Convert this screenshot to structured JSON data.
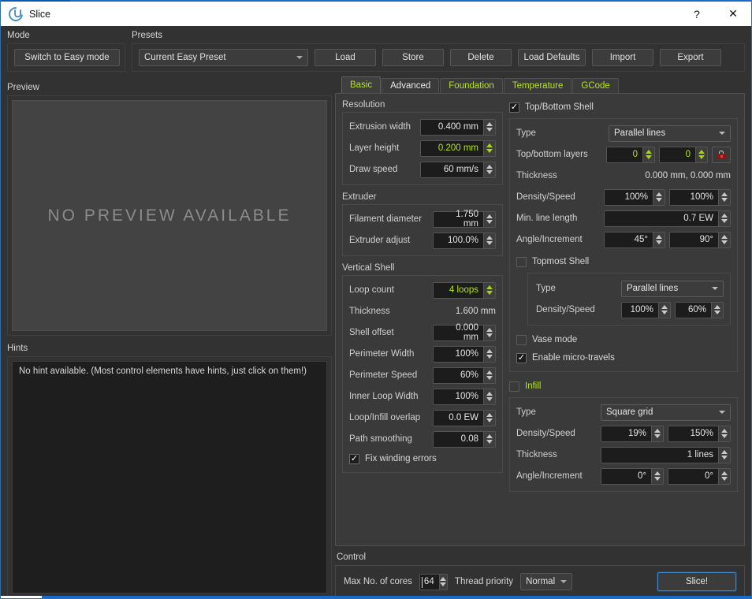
{
  "window": {
    "title": "Slice",
    "app_icon": "slice-logo-icon",
    "help_label": "?",
    "close_label": "✕"
  },
  "mode": {
    "group_label": "Mode",
    "switch_button": "Switch to Easy mode"
  },
  "presets": {
    "group_label": "Presets",
    "selected": "Current Easy Preset",
    "buttons": [
      "Load",
      "Store",
      "Delete",
      "Load Defaults",
      "Import",
      "Export"
    ]
  },
  "preview": {
    "group_label": "Preview",
    "placeholder": "NO  PREVIEW  AVAILABLE"
  },
  "hints": {
    "group_label": "Hints",
    "text": "No hint available. (Most control elements have hints, just click on them!)"
  },
  "tabs": [
    {
      "label": "Basic",
      "active": true,
      "color": "green"
    },
    {
      "label": "Advanced",
      "active": false,
      "color": "white"
    },
    {
      "label": "Foundation",
      "active": false,
      "color": "green"
    },
    {
      "label": "Temperature",
      "active": false,
      "color": "green"
    },
    {
      "label": "GCode",
      "active": false,
      "color": "green"
    }
  ],
  "basic": {
    "resolution": {
      "title": "Resolution",
      "rows": [
        {
          "label": "Extrusion width",
          "value": "0.400 mm",
          "modified": false
        },
        {
          "label": "Layer height",
          "value": "0.200 mm",
          "modified": true
        },
        {
          "label": "Draw speed",
          "value": "60 mm/s",
          "modified": false
        }
      ]
    },
    "extruder": {
      "title": "Extruder",
      "rows": [
        {
          "label": "Filament diameter",
          "value": "1.750 mm",
          "modified": false
        },
        {
          "label": "Extruder adjust",
          "value": "100.0%",
          "modified": false
        }
      ]
    },
    "vertical_shell": {
      "title": "Vertical Shell",
      "loop_count": {
        "label": "Loop count",
        "value": "4 loops",
        "modified": true
      },
      "thickness": {
        "label": "Thickness",
        "value": "1.600 mm"
      },
      "rows": [
        {
          "label": "Shell offset",
          "value": "0.000 mm",
          "modified": false
        },
        {
          "label": "Perimeter Width",
          "value": "100%",
          "modified": false
        },
        {
          "label": "Perimeter Speed",
          "value": "60%",
          "modified": false
        },
        {
          "label": "Inner Loop Width",
          "value": "100%",
          "modified": false
        },
        {
          "label": "Loop/Infill overlap",
          "value": "0.0 EW",
          "modified": false
        },
        {
          "label": "Path smoothing",
          "value": "0.08",
          "modified": false
        }
      ],
      "fix_winding": {
        "label": "Fix winding errors",
        "checked": true
      }
    },
    "top_bottom_shell": {
      "title": "Top/Bottom Shell",
      "checked": true,
      "type": {
        "label": "Type",
        "value": "Parallel lines"
      },
      "layers": {
        "label": "Top/bottom layers",
        "value_a": "0",
        "value_b": "0",
        "modified": true,
        "lock_icon": "lock-icon"
      },
      "thickness": {
        "label": "Thickness",
        "value": "0.000 mm, 0.000 mm"
      },
      "density_speed": {
        "label": "Density/Speed",
        "value_a": "100%",
        "value_b": "100%"
      },
      "min_line_length": {
        "label": "Min. line length",
        "value": "0.7 EW"
      },
      "angle_increment": {
        "label": "Angle/Increment",
        "value_a": "45°",
        "value_b": "90°"
      }
    },
    "topmost_shell": {
      "title": "Topmost Shell",
      "checked": false,
      "type": {
        "label": "Type",
        "value": "Parallel lines"
      },
      "density_speed": {
        "label": "Density/Speed",
        "value_a": "100%",
        "value_b": "60%"
      }
    },
    "vase_mode": {
      "label": "Vase mode",
      "checked": false
    },
    "micro_travels": {
      "label": "Enable micro-travels",
      "checked": true
    },
    "infill": {
      "title": "Infill",
      "checked": false,
      "type": {
        "label": "Type",
        "value": "Square grid"
      },
      "density_speed": {
        "label": "Density/Speed",
        "value_a": "19%",
        "value_b": "150%"
      },
      "thickness": {
        "label": "Thickness",
        "value": "1 lines"
      },
      "angle_increment": {
        "label": "Angle/Increment",
        "value_a": "0°",
        "value_b": "0°"
      }
    }
  },
  "control": {
    "title": "Control",
    "cores_label": "Max No. of cores",
    "cores_value": "64",
    "thread_label": "Thread priority",
    "thread_value": "Normal",
    "slice_button": "Slice!"
  },
  "colors": {
    "accent_green": "#b5e61d",
    "title_blue": "#1b6ac9",
    "focus_blue": "#3f87c8",
    "lock_red": "#8c1515"
  }
}
